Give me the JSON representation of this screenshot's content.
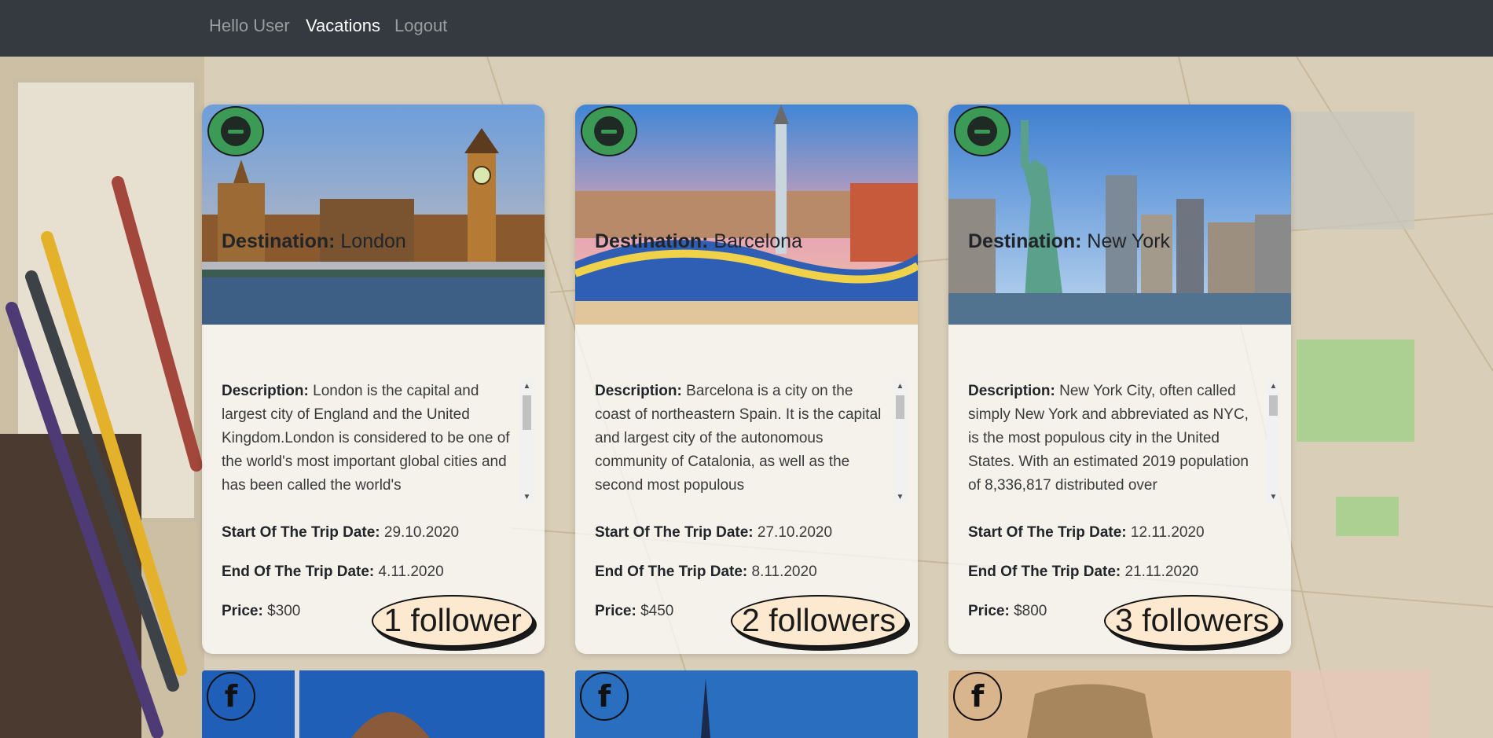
{
  "nav": {
    "hello": "Hello User",
    "vacations": "Vacations",
    "logout": "Logout"
  },
  "labels": {
    "destination": "Destination:",
    "description": "Description:",
    "start": "Start Of The Trip Date:",
    "end": "End Of The Trip Date:",
    "price": "Price:"
  },
  "vacations": [
    {
      "destination": "London",
      "description": "London is the capital and largest city of England and the United Kingdom.London is considered to be one of the world's most important global cities and has been called the world's",
      "start": "29.10.2020",
      "end": "4.11.2020",
      "price": "$300",
      "followers": "1 follower",
      "followed": true
    },
    {
      "destination": "Barcelona",
      "description": "Barcelona is a city on the coast of northeastern Spain. It is the capital and largest city of the autonomous community of Catalonia, as well as the second most populous",
      "start": "27.10.2020",
      "end": "8.11.2020",
      "price": "$450",
      "followers": "2 followers",
      "followed": true
    },
    {
      "destination": "New York",
      "description": "New York City, often called simply New York and abbreviated as NYC, is the most populous city in the United States. With an estimated 2019 population of 8,336,817 distributed over",
      "start": "12.11.2020",
      "end": "21.11.2020",
      "price": "$800",
      "followers": "3 followers",
      "followed": true
    }
  ],
  "icons": {
    "unfollow": "minus-circle-icon",
    "follow": "facebook-icon",
    "scroll_up": "triangle-up",
    "scroll_down": "triangle-down"
  },
  "colors": {
    "navbar": "#343a40",
    "followed_badge": "#3c9a57",
    "followers_bubble": "#fde9cf"
  }
}
